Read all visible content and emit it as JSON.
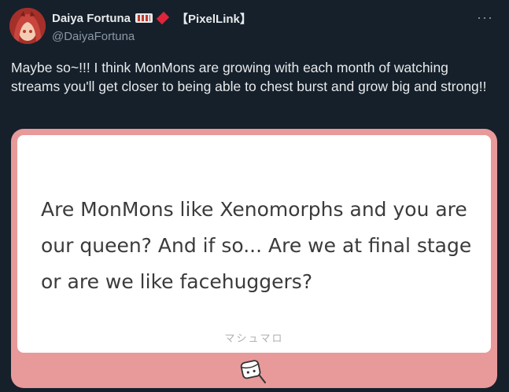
{
  "header": {
    "display_name": "Daiya Fortuna",
    "tag": "【PixelLink】",
    "handle": "@DaiyaFortuna",
    "more_icon": "more-horizontal-icon",
    "more_glyph": "···"
  },
  "tweet": {
    "text": "Maybe so~!!! I think MonMons are growing with each month of watching streams you'll get closer to being able to chest burst and grow big and strong!!"
  },
  "media": {
    "question": "Are MonMons like Xenomorphs and you are our queen? And if so... Are we at final stage or are we like facehuggers?",
    "site_label": "マシュマロ",
    "logo_icon": "marshmallow-icon"
  },
  "colors": {
    "background": "#15202b",
    "text": "#e7e9ea",
    "muted": "#8b98a5",
    "media_border": "#e8999a",
    "diamond": "#e0253a"
  }
}
